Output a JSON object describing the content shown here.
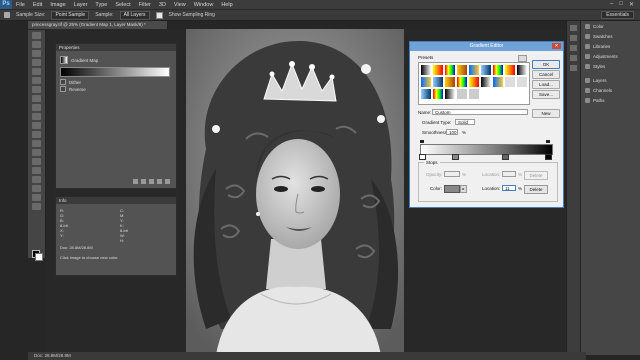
{
  "menubar": {
    "items": [
      "File",
      "Edit",
      "Image",
      "Layer",
      "Type",
      "Select",
      "Filter",
      "3D",
      "View",
      "Window",
      "Help"
    ],
    "controls": [
      "–",
      "□",
      "✕"
    ]
  },
  "optionsbar": {
    "sample_size_label": "Sample Size:",
    "sample_size_value": "Point Sample",
    "sample_label": "Sample:",
    "sample_value": "All Layers",
    "show_ring_label": "Show Sampling Ring",
    "workspace": "Essentials"
  },
  "document": {
    "tab": "princessgray.tif @ 25% (Gradient Map 1, Layer Mask/8) *",
    "status": "Doc: 28.8M/28.8M"
  },
  "properties": {
    "title": "Properties",
    "layer_type": "Gradient Map",
    "dither_label": "Dither",
    "reverse_label": "Reverse"
  },
  "info": {
    "title": "Info",
    "labels": [
      "R:",
      "G:",
      "B:",
      "C:",
      "M:",
      "Y:",
      "K:",
      "8-bit",
      "8-bit",
      "X:",
      "Y:",
      "W:",
      "H:"
    ],
    "doc": "Doc: 28.8M/28.8M",
    "hint": "Click image to choose new color."
  },
  "gradient_editor": {
    "title": "Gradient Editor",
    "presets_label": "Presets",
    "buttons": {
      "ok": "OK",
      "cancel": "Cancel",
      "load": "Load...",
      "save": "Save...",
      "new": "New",
      "delete": "Delete",
      "delete2": "Delete"
    },
    "name_label": "Name:",
    "name_value": "Custom",
    "type_label": "Gradient Type:",
    "type_value": "Solid",
    "smooth_label": "Smoothness:",
    "smooth_value": "100",
    "smooth_unit": "%",
    "stops_label": "Stops",
    "opacity_label": "Opacity:",
    "opacity_unit": "%",
    "location_label": "Location:",
    "location_unit": "%",
    "color_label": "Color:",
    "location_label2": "Location:",
    "location_value": "11",
    "location_unit2": "%"
  },
  "right_dock": {
    "items": [
      "Color",
      "Swatches",
      "Libraries",
      "Adjustments",
      "Styles",
      "Layers",
      "Channels",
      "Paths"
    ]
  },
  "colors": {
    "accent": "#3f7fc2",
    "panel": "#535353",
    "bg": "#262626"
  }
}
